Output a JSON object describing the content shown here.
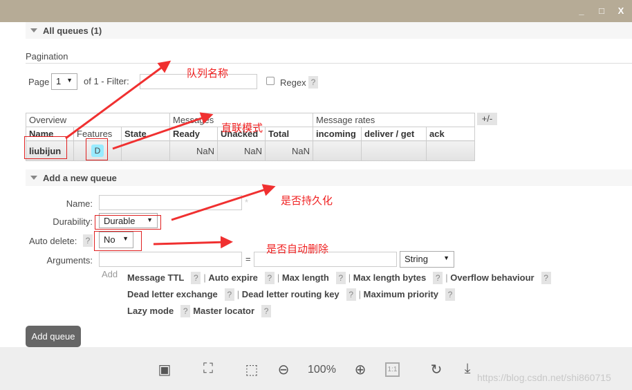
{
  "window": {
    "minimize": "_",
    "maximize": "□",
    "close": "X"
  },
  "all_queues": {
    "title": "All queues (1)",
    "pagination_label": "Pagination",
    "page_label": "Page",
    "page_value": "1",
    "of_label": "of 1  - Filter:",
    "filter_value": "",
    "regex_label": "Regex",
    "help": "?"
  },
  "table": {
    "groups": [
      "Overview",
      "Messages",
      "Message rates"
    ],
    "toggle": "+/-",
    "headers": [
      "Name",
      "Features",
      "State",
      "Ready",
      "Unacked",
      "Total",
      "incoming",
      "deliver / get",
      "ack"
    ],
    "rows": [
      {
        "name": "liubijun",
        "feature": "D",
        "state": "",
        "ready": "NaN",
        "unacked": "NaN",
        "total": "NaN",
        "incoming": "",
        "deliver_get": "",
        "ack": ""
      }
    ]
  },
  "add_queue": {
    "title": "Add a new queue",
    "name_label": "Name:",
    "name_value": "",
    "required_mark": "*",
    "durability_label": "Durability:",
    "durability_value": "Durable",
    "auto_delete_label": "Auto delete:",
    "auto_delete_value": "No",
    "arguments_label": "Arguments:",
    "equals": "=",
    "type_value": "String",
    "add_link": "Add",
    "arg_links": [
      [
        "Message TTL",
        "Auto expire",
        "Max length",
        "Max length bytes",
        "Overflow behaviour"
      ],
      [
        "Dead letter exchange",
        "Dead letter routing key",
        "Maximum priority"
      ],
      [
        "Lazy mode",
        "Master locator"
      ]
    ],
    "submit": "Add queue"
  },
  "annotations": {
    "queue_name": "队列名称",
    "direct_mode": "直联模式",
    "durable": "是否持久化",
    "auto_delete": "是否自动删除",
    "color": "#f02020"
  },
  "viewer": {
    "zoom": "100%",
    "one_to_one": "1:1",
    "watermark": "https://blog.csdn.net/shi860715"
  }
}
